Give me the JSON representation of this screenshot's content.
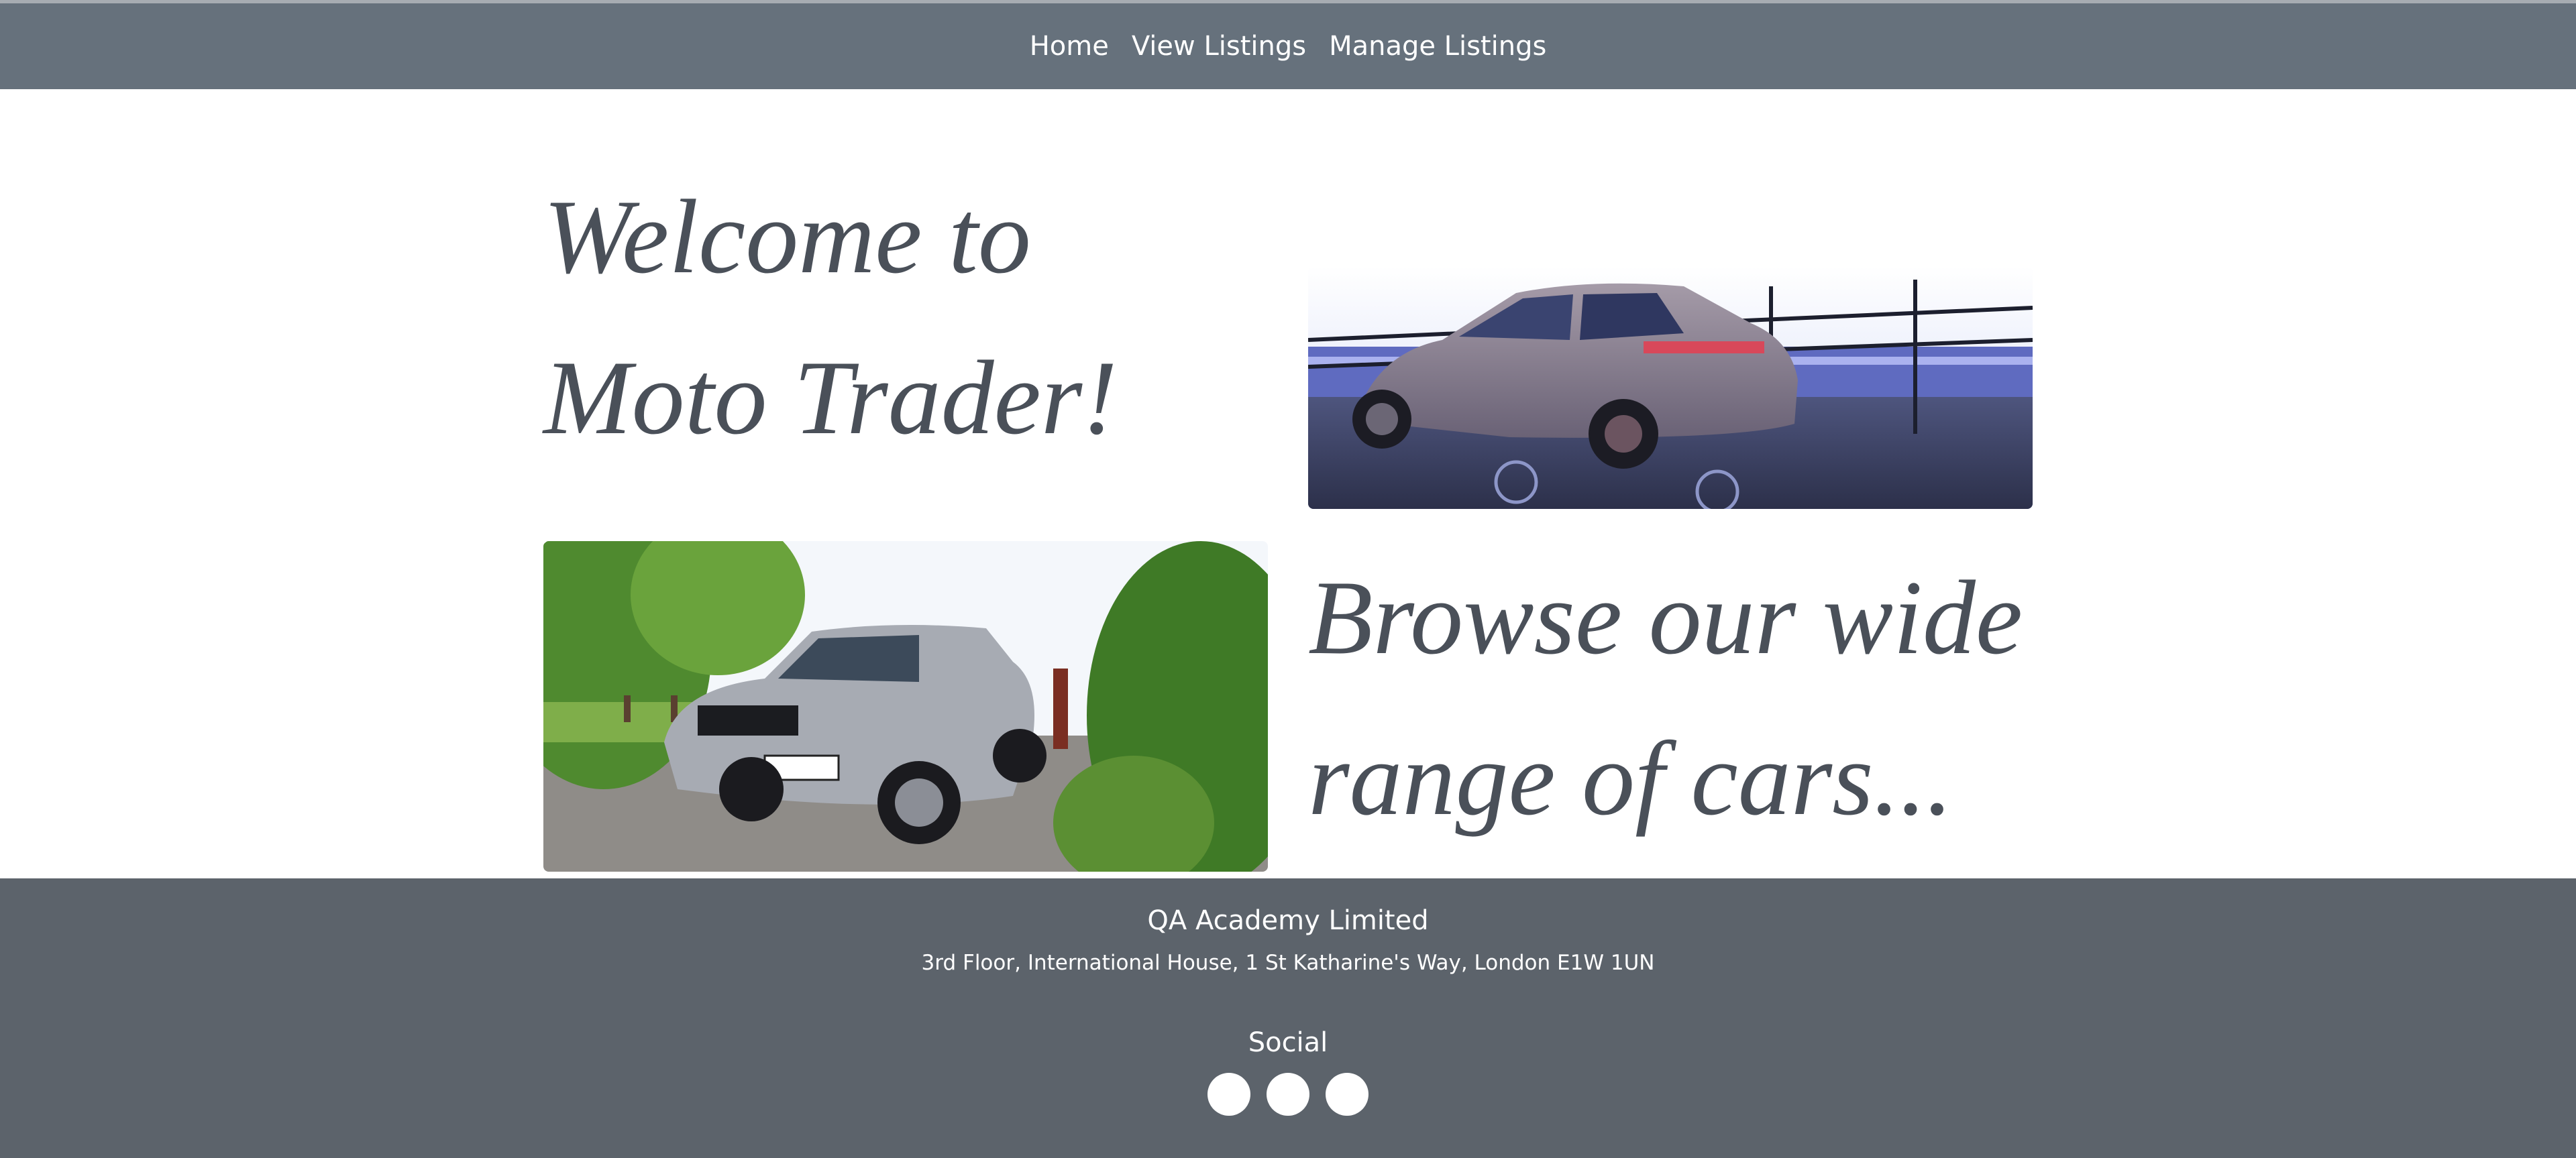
{
  "nav": {
    "links": [
      "Home",
      "View Listings",
      "Manage Listings"
    ]
  },
  "hero": {
    "welcome_line1": "Welcome to",
    "welcome_line2": "Moto Trader!",
    "browse_line1": "Browse our wide",
    "browse_line2": "range of cars..."
  },
  "footer": {
    "company": "QA Academy Limited",
    "address": "3rd Floor, International House, 1 St Katharine's Way, London E1W 1UN",
    "social_heading": "Social",
    "social_icons": [
      "social-icon",
      "social-icon",
      "social-icon"
    ]
  },
  "colors": {
    "navbar": "#66717c",
    "footer": "#5c636b",
    "heading_text": "#4a5059"
  }
}
